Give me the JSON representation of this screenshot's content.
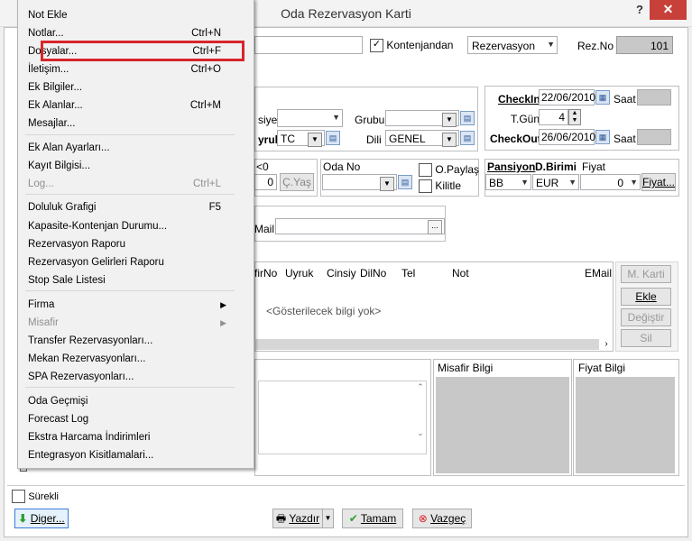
{
  "window": {
    "title": "Oda Rezervasyon Karti",
    "help": "?",
    "close": "✕"
  },
  "top": {
    "kontenjandan": "Kontenjandan",
    "rez_type": "Rezervasyon",
    "rezno_label": "Rez.No",
    "rezno_value": "101"
  },
  "guest": {
    "cinsiyet_label": "siyet",
    "grubu_label": "Grubu",
    "uyruk_label": "yruk",
    "uyruk_value": "TC",
    "dili_label": "Dili",
    "dili_value": "GENEL"
  },
  "dates": {
    "checkin_label": "CheckIn",
    "checkin_value": "22/06/2010",
    "saat1": "Saat",
    "tgun_label": "T.Gün",
    "tgun_value": "4",
    "checkout_label": "CheckOut",
    "checkout_value": "26/06/2010",
    "saat2": "Saat"
  },
  "room": {
    "lt0": "<0",
    "count_value": "0",
    "cyas_button": "Ç.Yaş",
    "odano_label": "Oda No",
    "opaylas": "O.Paylaş",
    "kilitle": "Kilitle"
  },
  "pricing": {
    "pansiyon_label": "Pansiyon",
    "dbirimi_label": "D.Birimi",
    "fiyat_label": "Fiyat",
    "pansiyon_value": "BB",
    "currency_value": "EUR",
    "fiyat_value": "0",
    "fiyat_button": "Fiyat..."
  },
  "email": {
    "label": "Mail"
  },
  "grid": {
    "columns": [
      "firNo",
      "Uyruk",
      "Cinsiy",
      "DilNo",
      "Tel",
      "Not",
      "EMail"
    ],
    "empty_text": "<Gösterilecek bilgi yok>"
  },
  "side_buttons": [
    "M. Karti",
    "Ekle",
    "Değiştir",
    "Sil"
  ],
  "panels": {
    "misafir": "Misafir Bilgi",
    "fiyat": "Fiyat Bilgi"
  },
  "bottom": {
    "surekli": "Sürekli",
    "diger": "Diger...",
    "yazdir": "Yazdır",
    "tamam": "Tamam",
    "vazgec": "Vazgeç"
  },
  "menu": {
    "items": [
      {
        "label": "Not Ekle",
        "shortcut": ""
      },
      {
        "label": "Notlar...",
        "shortcut": "Ctrl+N"
      },
      {
        "label": "Dosyalar...",
        "shortcut": "Ctrl+F"
      },
      {
        "label": "İletişim...",
        "shortcut": "Ctrl+O"
      },
      {
        "label": "Ek Bilgiler...",
        "shortcut": ""
      },
      {
        "label": "Ek Alanlar...",
        "shortcut": "Ctrl+M"
      },
      {
        "label": "Mesajlar...",
        "shortcut": ""
      },
      {
        "label": "Ek Alan Ayarları...",
        "shortcut": ""
      },
      {
        "label": "Kayıt Bilgisi...",
        "shortcut": ""
      },
      {
        "label": "Log...",
        "shortcut": "Ctrl+L"
      },
      {
        "label": "Doluluk Grafigi",
        "shortcut": "F5"
      },
      {
        "label": "Kapasite-Kontenjan Durumu...",
        "shortcut": ""
      },
      {
        "label": "Rezervasyon Raporu",
        "shortcut": ""
      },
      {
        "label": "Rezervasyon Gelirleri Raporu",
        "shortcut": ""
      },
      {
        "label": "Stop Sale Listesi",
        "shortcut": ""
      },
      {
        "label": "Firma",
        "shortcut": ""
      },
      {
        "label": "Misafir",
        "shortcut": ""
      },
      {
        "label": "Transfer Rezervasyonları...",
        "shortcut": ""
      },
      {
        "label": "Mekan Rezervasyonları...",
        "shortcut": ""
      },
      {
        "label": "SPA Rezervasyonları...",
        "shortcut": ""
      },
      {
        "label": "Oda Geçmişi",
        "shortcut": ""
      },
      {
        "label": "Forecast Log",
        "shortcut": ""
      },
      {
        "label": "Ekstra Harcama İndirimleri",
        "shortcut": ""
      },
      {
        "label": "Entegrasyon Kisitlamalari...",
        "shortcut": ""
      }
    ]
  }
}
